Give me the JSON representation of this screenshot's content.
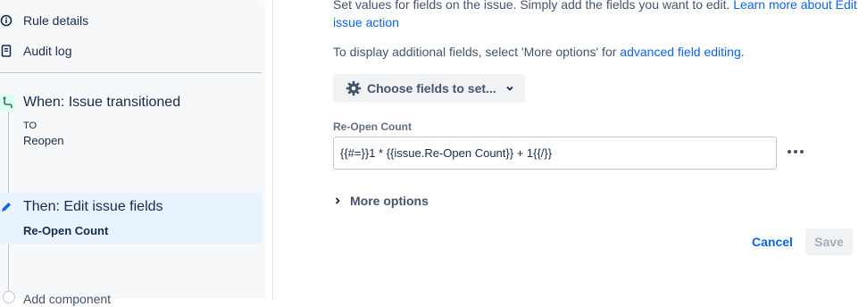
{
  "sidebar": {
    "nav": [
      {
        "label": "Rule details",
        "icon": "info-icon"
      },
      {
        "label": "Audit log",
        "icon": "document-icon"
      }
    ],
    "trigger": {
      "title": "When: Issue transitioned",
      "to_label": "TO",
      "status": "Reopen",
      "icon": "transition-icon"
    },
    "action": {
      "title": "Then: Edit issue fields",
      "field": "Re-Open Count",
      "icon": "pencil-icon"
    },
    "add_component": "Add component"
  },
  "main": {
    "intro_text": "Set values for fields on the issue. Simply add the fields you want to edit. ",
    "intro_link": "Learn more about Edit issue action",
    "hint_text": "To display additional fields, select 'More options' for ",
    "hint_link": "advanced field editing",
    "hint_end": ".",
    "choose_fields_label": "Choose fields to set...",
    "field": {
      "label": "Re-Open Count",
      "value": "{{#=}}1 * {{issue.Re-Open Count}} + 1{{/}}"
    },
    "more_options_label": "More options",
    "cancel_label": "Cancel",
    "save_label": "Save"
  },
  "colors": {
    "link": "#0c66e4",
    "selected_bg": "#e9f2ff",
    "trigger_bg": "#dffcf0",
    "trigger_icon": "#1f845a"
  }
}
